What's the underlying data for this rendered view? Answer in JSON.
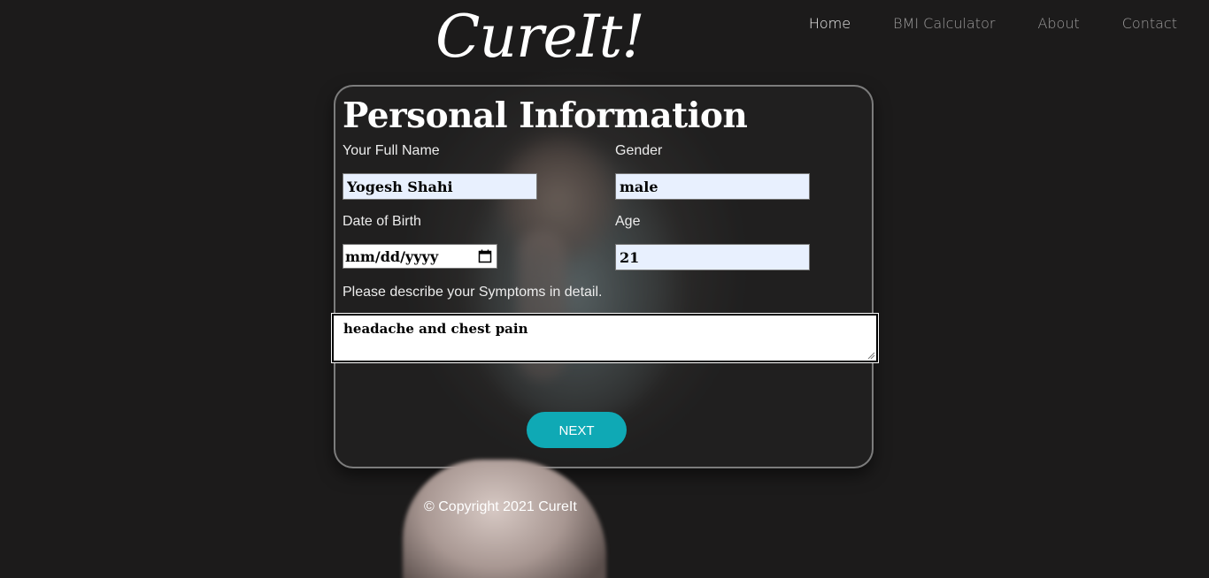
{
  "brand": {
    "logo_text": "CureIt!"
  },
  "nav": {
    "items": [
      {
        "label": "Home",
        "active": true
      },
      {
        "label": "BMI Calculator",
        "active": false
      },
      {
        "label": "About",
        "active": false
      },
      {
        "label": "Contact",
        "active": false
      }
    ]
  },
  "form": {
    "title": "Personal Information",
    "full_name": {
      "label": "Your Full Name",
      "value": "Yogesh Shahi"
    },
    "gender": {
      "label": "Gender",
      "value": "male"
    },
    "dob": {
      "label": "Date of Birth",
      "placeholder": "mm/dd/yyyy"
    },
    "age": {
      "label": "Age",
      "value": "21"
    },
    "symptoms": {
      "label": "Please describe your Symptoms in detail.",
      "value": "headache and chest pain"
    },
    "next_label": "NEXT"
  },
  "footer": {
    "text": "© Copyright 2021 CureIt"
  },
  "colors": {
    "accent": "#0fa9b5",
    "input_bg": "#e8f0fe",
    "page_bg": "#1c1b1b"
  }
}
